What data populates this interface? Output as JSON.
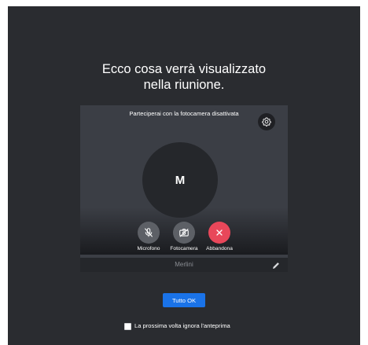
{
  "headline": {
    "line1": "Ecco cosa verrà visualizzato",
    "line2": "nella riunione."
  },
  "preview": {
    "notice": "Parteciperai con la fotocamera disattivata",
    "settings_icon": "gear-icon",
    "avatar_initial": "M",
    "controls": [
      {
        "label": "Microfono",
        "icon": "microphone-off-icon",
        "color": "#5d6066"
      },
      {
        "label": "Fotocamera",
        "icon": "camera-off-icon",
        "color": "#5d6066"
      },
      {
        "label": "Abbandona",
        "icon": "close-icon",
        "color": "#e8475a"
      }
    ],
    "name_placeholder": "Merlini",
    "edit_icon": "pencil-icon"
  },
  "ok_button": {
    "label": "Tutto OK",
    "color": "#1a73e8"
  },
  "skip_preview": {
    "label": "La prossima volta ignora l'anteprima",
    "checked": false
  }
}
